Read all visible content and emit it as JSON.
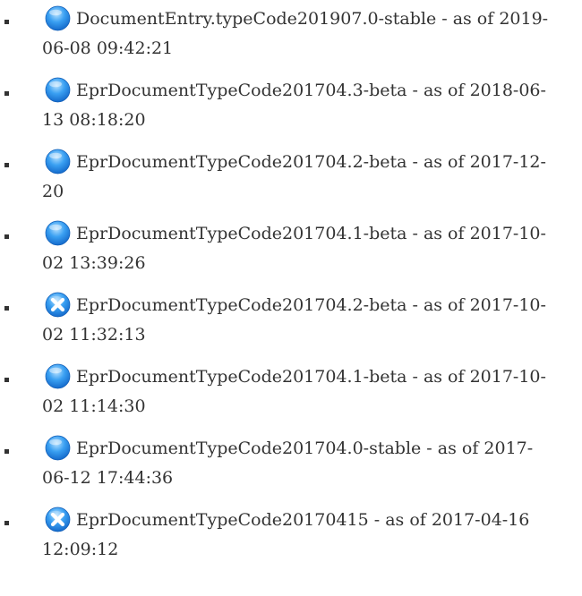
{
  "colors": {
    "text": "#333333",
    "bullet": "#333333",
    "status_blue": "#2c8ee8",
    "status_error": "#2c8ee8"
  },
  "history": {
    "items": [
      {
        "icon": "blue-circle-icon",
        "label": "DocumentEntry.typeCode201907.0-stable - as of 2019-06-08 09:42:21"
      },
      {
        "icon": "blue-circle-icon",
        "label": "EprDocumentTypeCode201704.3-beta - as of 2018-06-13 08:18:20"
      },
      {
        "icon": "blue-circle-icon",
        "label": "EprDocumentTypeCode201704.2-beta - as of 2017-12-20"
      },
      {
        "icon": "blue-circle-icon",
        "label": "EprDocumentTypeCode201704.1-beta - as of 2017-10-02 13:39:26"
      },
      {
        "icon": "x-circle-icon",
        "label": "EprDocumentTypeCode201704.2-beta - as of 2017-10-02 11:32:13"
      },
      {
        "icon": "blue-circle-icon",
        "label": "EprDocumentTypeCode201704.1-beta - as of 2017-10-02 11:14:30"
      },
      {
        "icon": "blue-circle-icon",
        "label": "EprDocumentTypeCode201704.0-stable - as of 2017-06-12 17:44:36"
      },
      {
        "icon": "x-circle-icon",
        "label": "EprDocumentTypeCode20170415 - as of 2017-04-16 12:09:12"
      }
    ]
  }
}
